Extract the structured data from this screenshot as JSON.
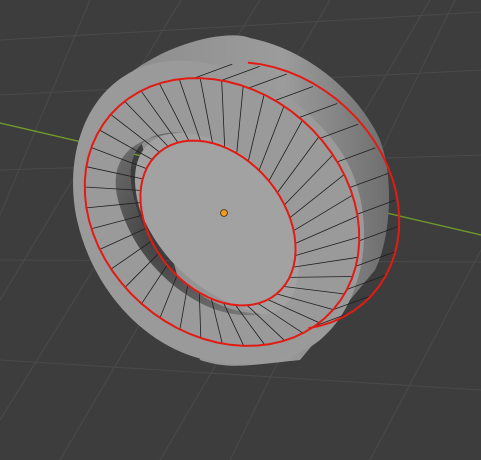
{
  "viewport": {
    "background": "#3d3d3d",
    "grid_color": "#4a4a4a",
    "x_axis_color": "#6e9a2a",
    "selection_color": "#e21b14",
    "edge_color": "#1e1e1e",
    "origin_color": "#f29d1f",
    "mesh_object": "ring-mesh",
    "shading": "solid"
  }
}
